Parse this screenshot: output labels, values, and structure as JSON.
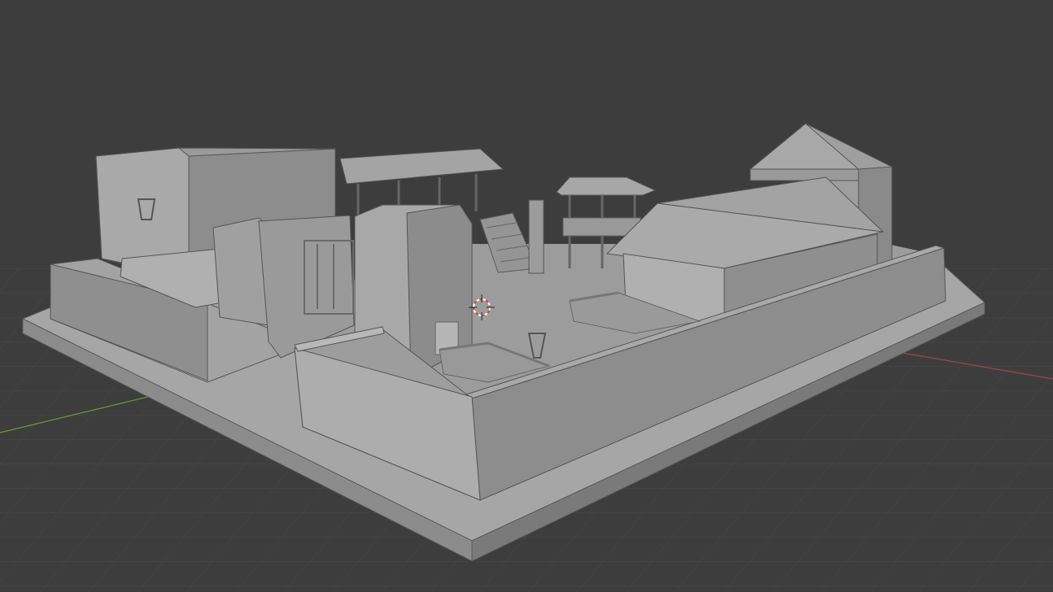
{
  "viewport": {
    "mode": "3d-viewport-solid-shading",
    "background": "#3d3d3d",
    "grid_color": "#4a4a4a",
    "x_axis_color": "#a8434f",
    "y_axis_color": "#6f9a2f",
    "surface_light": "#a9a9a9",
    "surface_mid": "#8e8e8e",
    "surface_dark": "#7a7a7a",
    "edge_color": "#555555",
    "cursor_color": "#e04040"
  },
  "scene": {
    "objects": [
      "base-platform",
      "perimeter-wall-front",
      "perimeter-wall-left",
      "perimeter-wall-right",
      "tall-block-building",
      "covered-porch-roof",
      "central-tower-block",
      "small-tower-pavilion",
      "long-gabled-house",
      "rear-gabled-tower",
      "wooden-walkways",
      "fire-baskets"
    ]
  },
  "cursor": {
    "icon": "3d-cursor-icon"
  }
}
